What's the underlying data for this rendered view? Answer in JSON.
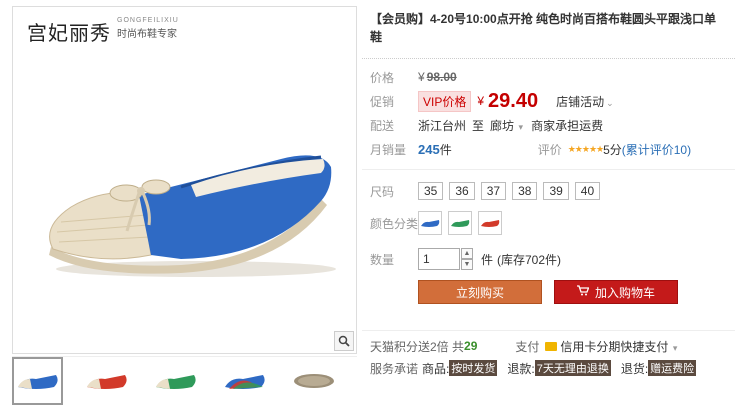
{
  "brand": {
    "name_cn": "宫妃丽秀",
    "name_en": "GONGFEILIXIU",
    "slogan": "时尚布鞋专家"
  },
  "product": {
    "title": "【会员购】4-20号10:00点开抢 纯色时尚百搭布鞋圆头平跟浅口单鞋"
  },
  "price": {
    "label": "价格",
    "currency": "¥",
    "original": "98.00",
    "promo_label": "促销",
    "vip_tag": "VIP价格",
    "promo_price": "29.40",
    "activity": "店铺活动"
  },
  "shipping": {
    "label": "配送",
    "from": "浙江台州",
    "to_word": "至",
    "to": "廊坊",
    "fee": "商家承担运费"
  },
  "sales": {
    "label": "月销量",
    "count": "245",
    "unit": "件",
    "rate_label": "评价",
    "stars": "★★★★★",
    "score": "5分",
    "review_link": "(累计评价10)"
  },
  "options": {
    "size_label": "尺码",
    "sizes": [
      "35",
      "36",
      "37",
      "38",
      "39",
      "40"
    ],
    "color_label": "颜色分类",
    "qty_label": "数量",
    "qty_value": "1",
    "unit": "件",
    "stock": "(库存702件)"
  },
  "actions": {
    "buy_now": "立刻购买",
    "add_cart": "加入购物车"
  },
  "extras": {
    "points_text": "天猫积分送2倍 共",
    "points_num": "29",
    "pay_label": "支付",
    "pay_text": "信用卡分期快捷支付",
    "service_label": "服务承诺",
    "goods_label": "商品:",
    "goods_tag": "按时发货",
    "return_label": "退款:",
    "return_tag": "7天无理由退换",
    "refund_label": "退货:",
    "refund_tag": "赠运费险"
  },
  "colors": {
    "blue": "#2f6ac4",
    "red": "#d23a2a",
    "green": "#2f9a5a",
    "price_red": "#c40000",
    "link_blue": "#2b6fb6"
  }
}
